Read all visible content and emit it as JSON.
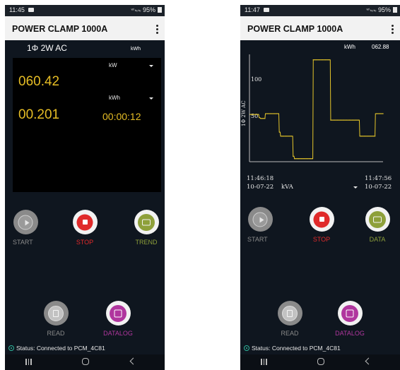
{
  "left_screen": {
    "status_bar": {
      "time": "11:45",
      "signal": "ᵛᵒ⁾ ₗₜₑ ₗₜₑ",
      "battery": "95%"
    },
    "app_title": "POWER CLAMP 1000A",
    "menu_icon": "more-vertical-icon",
    "mode": "1Φ 2W AC",
    "top_unit": "kWh",
    "display": {
      "unit1": "kW",
      "value1": "060.42",
      "unit2": "kWh",
      "value2": "00.201",
      "timer": "00:00:12"
    },
    "buttons": {
      "start": "START",
      "stop": "STOP",
      "trend": "TREND",
      "read": "READ",
      "datalog": "DATALOG"
    },
    "status_text": "Status: Connected to PCM_4C81"
  },
  "right_screen": {
    "status_bar": {
      "time": "11:47",
      "signal": "ᵛᵒ⁾ ₗₜₑ ₗₜₑ",
      "battery": "95%"
    },
    "app_title": "POWER CLAMP 1000A",
    "menu_icon": "more-vertical-icon",
    "top_unit": "kWh",
    "top_value": "062.88",
    "chart_data": {
      "type": "line",
      "ylabel": "1Φ 2W AC",
      "ytick_labels": [
        "100",
        "50"
      ],
      "ylim": [
        0,
        130
      ],
      "values": [
        57,
        57,
        57,
        57,
        57,
        57,
        57,
        57,
        57,
        57,
        57,
        57,
        57,
        57,
        57,
        57,
        57,
        57,
        57,
        57,
        53,
        53,
        53,
        52,
        52,
        52,
        52,
        52,
        52,
        52,
        52,
        52,
        52,
        52,
        58,
        58,
        58,
        58,
        58,
        58,
        58,
        58,
        58,
        58,
        58,
        58,
        58,
        58,
        58,
        58,
        58,
        58,
        58,
        58,
        58,
        58,
        58,
        58,
        58,
        58,
        58,
        58,
        58,
        58,
        58,
        35,
        35,
        35,
        30,
        30,
        30,
        30,
        30,
        30,
        30,
        30,
        30,
        30,
        30,
        30,
        30,
        30,
        30,
        30,
        30,
        30,
        30,
        30,
        30,
        30,
        30,
        30,
        30,
        30,
        30,
        30,
        5,
        5,
        5,
        2,
        2,
        2,
        2,
        2,
        2,
        2,
        2,
        2,
        2,
        2,
        2,
        2,
        2,
        2,
        2,
        2,
        2,
        2,
        2,
        2,
        2,
        2,
        2,
        2,
        2,
        2,
        2,
        2,
        2,
        2,
        2,
        2,
        2,
        2,
        2,
        2,
        2,
        2,
        2,
        2,
        2,
        125,
        125,
        125,
        125,
        125,
        125,
        125,
        125,
        125,
        125,
        125,
        125,
        125,
        125,
        125,
        125,
        125,
        125,
        125,
        125,
        125,
        125,
        125,
        125,
        125,
        125,
        125,
        125,
        125,
        125,
        125,
        125,
        125,
        125,
        125,
        125,
        125,
        125,
        125,
        50,
        50,
        50,
        50,
        50,
        50,
        50,
        50,
        50,
        50,
        50,
        50,
        50,
        50,
        50,
        50,
        50,
        50,
        50,
        50,
        50,
        50,
        50,
        50,
        50,
        50,
        50,
        50,
        50,
        50,
        50,
        50,
        50,
        50,
        50,
        50,
        50,
        50,
        50,
        50,
        50,
        50,
        50,
        50,
        50,
        50,
        50,
        50,
        50,
        50,
        50,
        50,
        50,
        50,
        50,
        50,
        50,
        50,
        50,
        50,
        50,
        50,
        50,
        50,
        50,
        30,
        30,
        30,
        30,
        30,
        30,
        30,
        30,
        30,
        30,
        30,
        30,
        30,
        30,
        30,
        30,
        30,
        30,
        30,
        30,
        30,
        30,
        30,
        30,
        30,
        30,
        30,
        30,
        30,
        30,
        30,
        30,
        30,
        30,
        30,
        58,
        58,
        58,
        58,
        58,
        58,
        58,
        58,
        58,
        58,
        58,
        58,
        58,
        58,
        58,
        58,
        58,
        58
      ],
      "line_color": "#e6c62a"
    },
    "time_start": "11:46:18",
    "date_start": "10-07-22",
    "time_end": "11:47:56",
    "date_end": "10-07-22",
    "unit_select": "kVA",
    "buttons": {
      "start": "START",
      "stop": "STOP",
      "data": "DATA",
      "read": "READ",
      "datalog": "DATALOG"
    },
    "status_text": "Status: Connected to PCM_4C81"
  },
  "colors": {
    "background": "#0f161f",
    "yellow": "#e6bd25",
    "stop_red": "#e02a2a",
    "trend_green": "#8ea03a",
    "datalog_purple": "#b0369e",
    "status_teal": "#2fb59a"
  }
}
